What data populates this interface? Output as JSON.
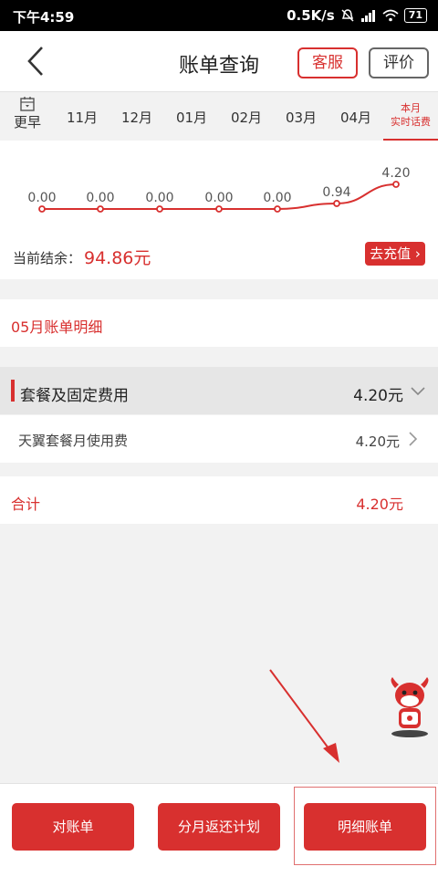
{
  "status": {
    "time": "下午4:59",
    "speed": "0.5K/s",
    "battery": "71"
  },
  "header": {
    "title": "账单查询",
    "service_label": "客服",
    "rate_label": "评价"
  },
  "tabs": {
    "earlier": "更早",
    "months": [
      "11月",
      "12月",
      "01月",
      "02月",
      "03月",
      "04月"
    ],
    "current_line1": "本月",
    "current_line2": "实时话费"
  },
  "chart_data": {
    "type": "line",
    "categories": [
      "11月",
      "12月",
      "01月",
      "02月",
      "03月",
      "04月",
      "本月"
    ],
    "values": [
      0.0,
      0.0,
      0.0,
      0.0,
      0.0,
      0.94,
      4.2
    ],
    "labels": [
      "0.00",
      "0.00",
      "0.00",
      "0.00",
      "0.00",
      "0.94",
      "4.20"
    ],
    "color": "#d8302f"
  },
  "balance": {
    "label": "当前结余：",
    "value": "94.86元",
    "recharge": "去充值"
  },
  "detail": {
    "month_title": "05月账单明细",
    "section_title": "套餐及固定费用",
    "section_amount": "4.20元",
    "item_title": "天翼套餐月使用费",
    "item_amount": "4.20元",
    "total_label": "合计",
    "total_amount": "4.20元"
  },
  "bottom": {
    "btn1": "对账单",
    "btn2": "分月返还计划",
    "btn3": "明细账单"
  },
  "colors": {
    "accent": "#d8302f"
  }
}
